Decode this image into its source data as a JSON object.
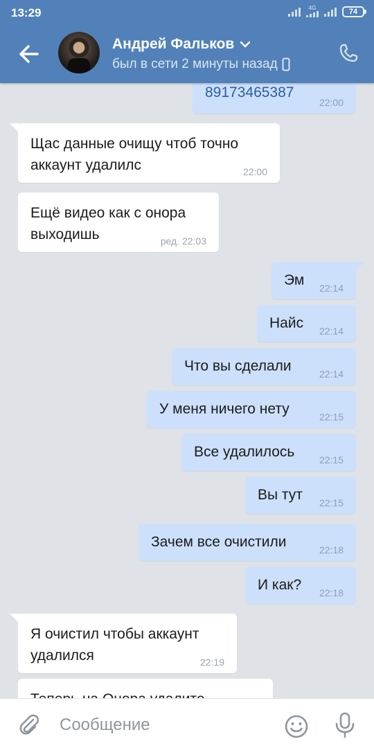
{
  "status_bar": {
    "time": "13:29",
    "network": "4G",
    "battery": "74"
  },
  "header": {
    "name": "Андрей Фальков",
    "status": "был в сети 2 минуты назад"
  },
  "messages": [
    {
      "text": "89173465387",
      "time": "22:00",
      "dir": "out"
    },
    {
      "text": "Щас данные очищу чтоб точно\nаккаунт удалилс",
      "time": "22:00",
      "dir": "in"
    },
    {
      "text": "Ещё видео как с онора\nвыходишь",
      "time": "ред. 22:03",
      "dir": "in"
    },
    {
      "text": "Эм",
      "time": "22:14",
      "dir": "out"
    },
    {
      "text": "Найс",
      "time": "22:14",
      "dir": "out"
    },
    {
      "text": "Что вы сделали",
      "time": "22:14",
      "dir": "out"
    },
    {
      "text": "У меня ничего нету",
      "time": "22:15",
      "dir": "out"
    },
    {
      "text": "Все удалилось",
      "time": "22:15",
      "dir": "out"
    },
    {
      "text": "Вы тут",
      "time": "22:15",
      "dir": "out"
    },
    {
      "text": "Зачем все очистили",
      "time": "22:18",
      "dir": "out"
    },
    {
      "text": "И как?",
      "time": "22:18",
      "dir": "out"
    },
    {
      "text": "Я очистил чтобы аккаунт\nудалился",
      "time": "22:19",
      "dir": "in"
    },
    {
      "text": "Теперь на Онора удалите",
      "time": "",
      "dir": "in"
    }
  ],
  "composer": {
    "placeholder": "Сообщение"
  },
  "colors": {
    "header": "#5181b8",
    "outgoing": "#cce0fb",
    "incoming": "#ffffff",
    "background": "#dfe2e7"
  }
}
